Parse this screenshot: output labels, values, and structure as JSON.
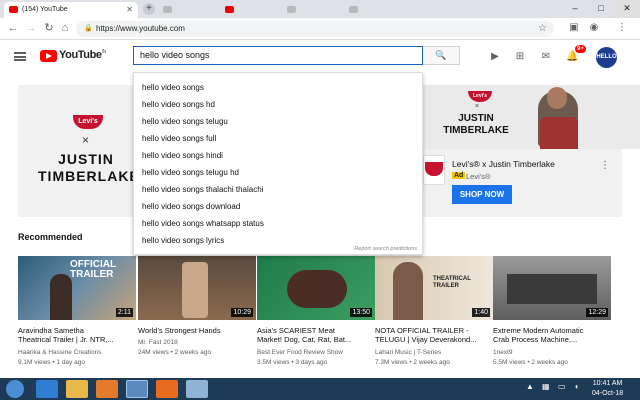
{
  "browser": {
    "tabs": [
      {
        "label": "(154) YouTube",
        "active": true
      },
      {
        "label": "",
        "active": false
      },
      {
        "label": "",
        "active": false
      },
      {
        "label": "",
        "active": false
      },
      {
        "label": "",
        "active": false
      }
    ],
    "address": "https://www.youtube.com",
    "window_controls": {
      "min": "–",
      "max": "□",
      "close": "✕"
    }
  },
  "youtube": {
    "logo_text": "YouTube",
    "logo_region": "IN",
    "search_value": "hello video songs",
    "notification_count": "9+",
    "avatar_label": "HELLO"
  },
  "suggestions": {
    "items": [
      "hello video songs",
      "hello video songs hd",
      "hello video songs telugu",
      "hello video songs full",
      "hello video songs hindi",
      "hello video songs telugu hd",
      "hello video songs thalachi thalachi",
      "hello video songs download",
      "hello video songs whatsapp status",
      "hello video songs lyrics"
    ],
    "report_text": "Report search predictions"
  },
  "banner": {
    "brand": "Levi's",
    "times": "×",
    "artist_line1": "JUSTIN",
    "artist_line2": "TIMBERLAKE",
    "ad_title": "Levi's® x Justin Timberlake",
    "ad_badge": "Ad",
    "ad_sub": "Levi's®",
    "shop_button": "SHOP NOW",
    "more": "⋮"
  },
  "recommended": {
    "heading": "Recommended",
    "videos": [
      {
        "duration": "2:11",
        "title_line1": "Aravindha Sametha",
        "title_line2": "Theatrical Trailer | Jr. NTR,...",
        "channel": "Haarika & Hassine Creations",
        "meta": "9.1M views • 1 day ago",
        "overlay": "OFFICIAL TRAILER"
      },
      {
        "duration": "10:29",
        "title_line1": "World's Strongest Hands",
        "title_line2": "",
        "channel": "Mr. Fast 2018",
        "meta": "24M views • 2 weeks ago",
        "overlay": ""
      },
      {
        "duration": "13:50",
        "title_line1": "Asia's SCARIEST Meat",
        "title_line2": "Market! Dog, Cat, Rat, Bat...",
        "channel": "Best Ever Food Review Show",
        "meta": "3.5M views • 3 days ago",
        "overlay": ""
      },
      {
        "duration": "1:40",
        "title_line1": "NOTA OFFICIAL TRAILER -",
        "title_line2": "TELUGU | Vijay Deverakond...",
        "channel": "Lahari Music | T-Series",
        "meta": "7.3M views • 2 weeks ago",
        "overlay": "THEATRICAL TRAILER"
      },
      {
        "duration": "12:29",
        "title_line1": "Extreme Modern Automatic",
        "title_line2": "Crab Process Machine,...",
        "channel": "1next9",
        "meta": "5.5M views • 2 weeks ago",
        "overlay": ""
      }
    ]
  },
  "taskbar": {
    "time": "10:41 AM",
    "date": "04-Oct-18"
  }
}
